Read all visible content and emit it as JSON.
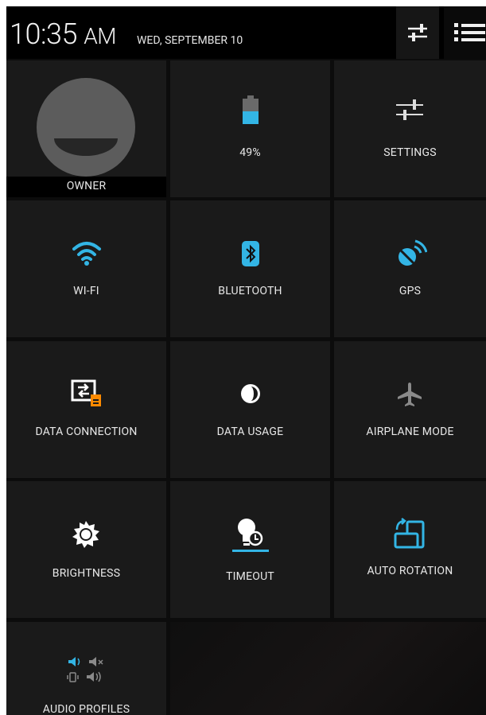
{
  "status_bar": {
    "time": "10:35",
    "ampm": "AM",
    "date": "WED, SEPTEMBER 10",
    "settings_button_icon": "sliders-icon",
    "notifications_button_icon": "list-icon"
  },
  "tiles": [
    {
      "label": "OWNER",
      "icon": "avatar-icon"
    },
    {
      "label": "49%",
      "icon": "battery-icon",
      "level": 0.49
    },
    {
      "label": "SETTINGS",
      "icon": "sliders-icon"
    },
    {
      "label": "WI-FI",
      "icon": "wifi-icon",
      "active": true
    },
    {
      "label": "BLUETOOTH",
      "icon": "bluetooth-icon",
      "active": true
    },
    {
      "label": "GPS",
      "icon": "gps-satellite-icon",
      "active": true
    },
    {
      "label": "DATA CONNECTION",
      "icon": "data-connection-icon"
    },
    {
      "label": "DATA USAGE",
      "icon": "data-usage-icon"
    },
    {
      "label": "AIRPLANE MODE",
      "icon": "airplane-icon",
      "active": false
    },
    {
      "label": "BRIGHTNESS",
      "icon": "brightness-icon"
    },
    {
      "label": "TIMEOUT",
      "icon": "timeout-icon"
    },
    {
      "label": "AUTO ROTATION",
      "icon": "auto-rotation-icon",
      "active": true
    },
    {
      "label": "AUDIO PROFILES",
      "icon": "audio-profiles-icon"
    }
  ],
  "colors": {
    "accent": "#33b5e5",
    "orange": "#ff8a00",
    "tile_bg": "#1a1a1a",
    "background": "#0c0c0c",
    "text": "#e8e8e8",
    "inactive_icon": "#8a8a8a"
  }
}
